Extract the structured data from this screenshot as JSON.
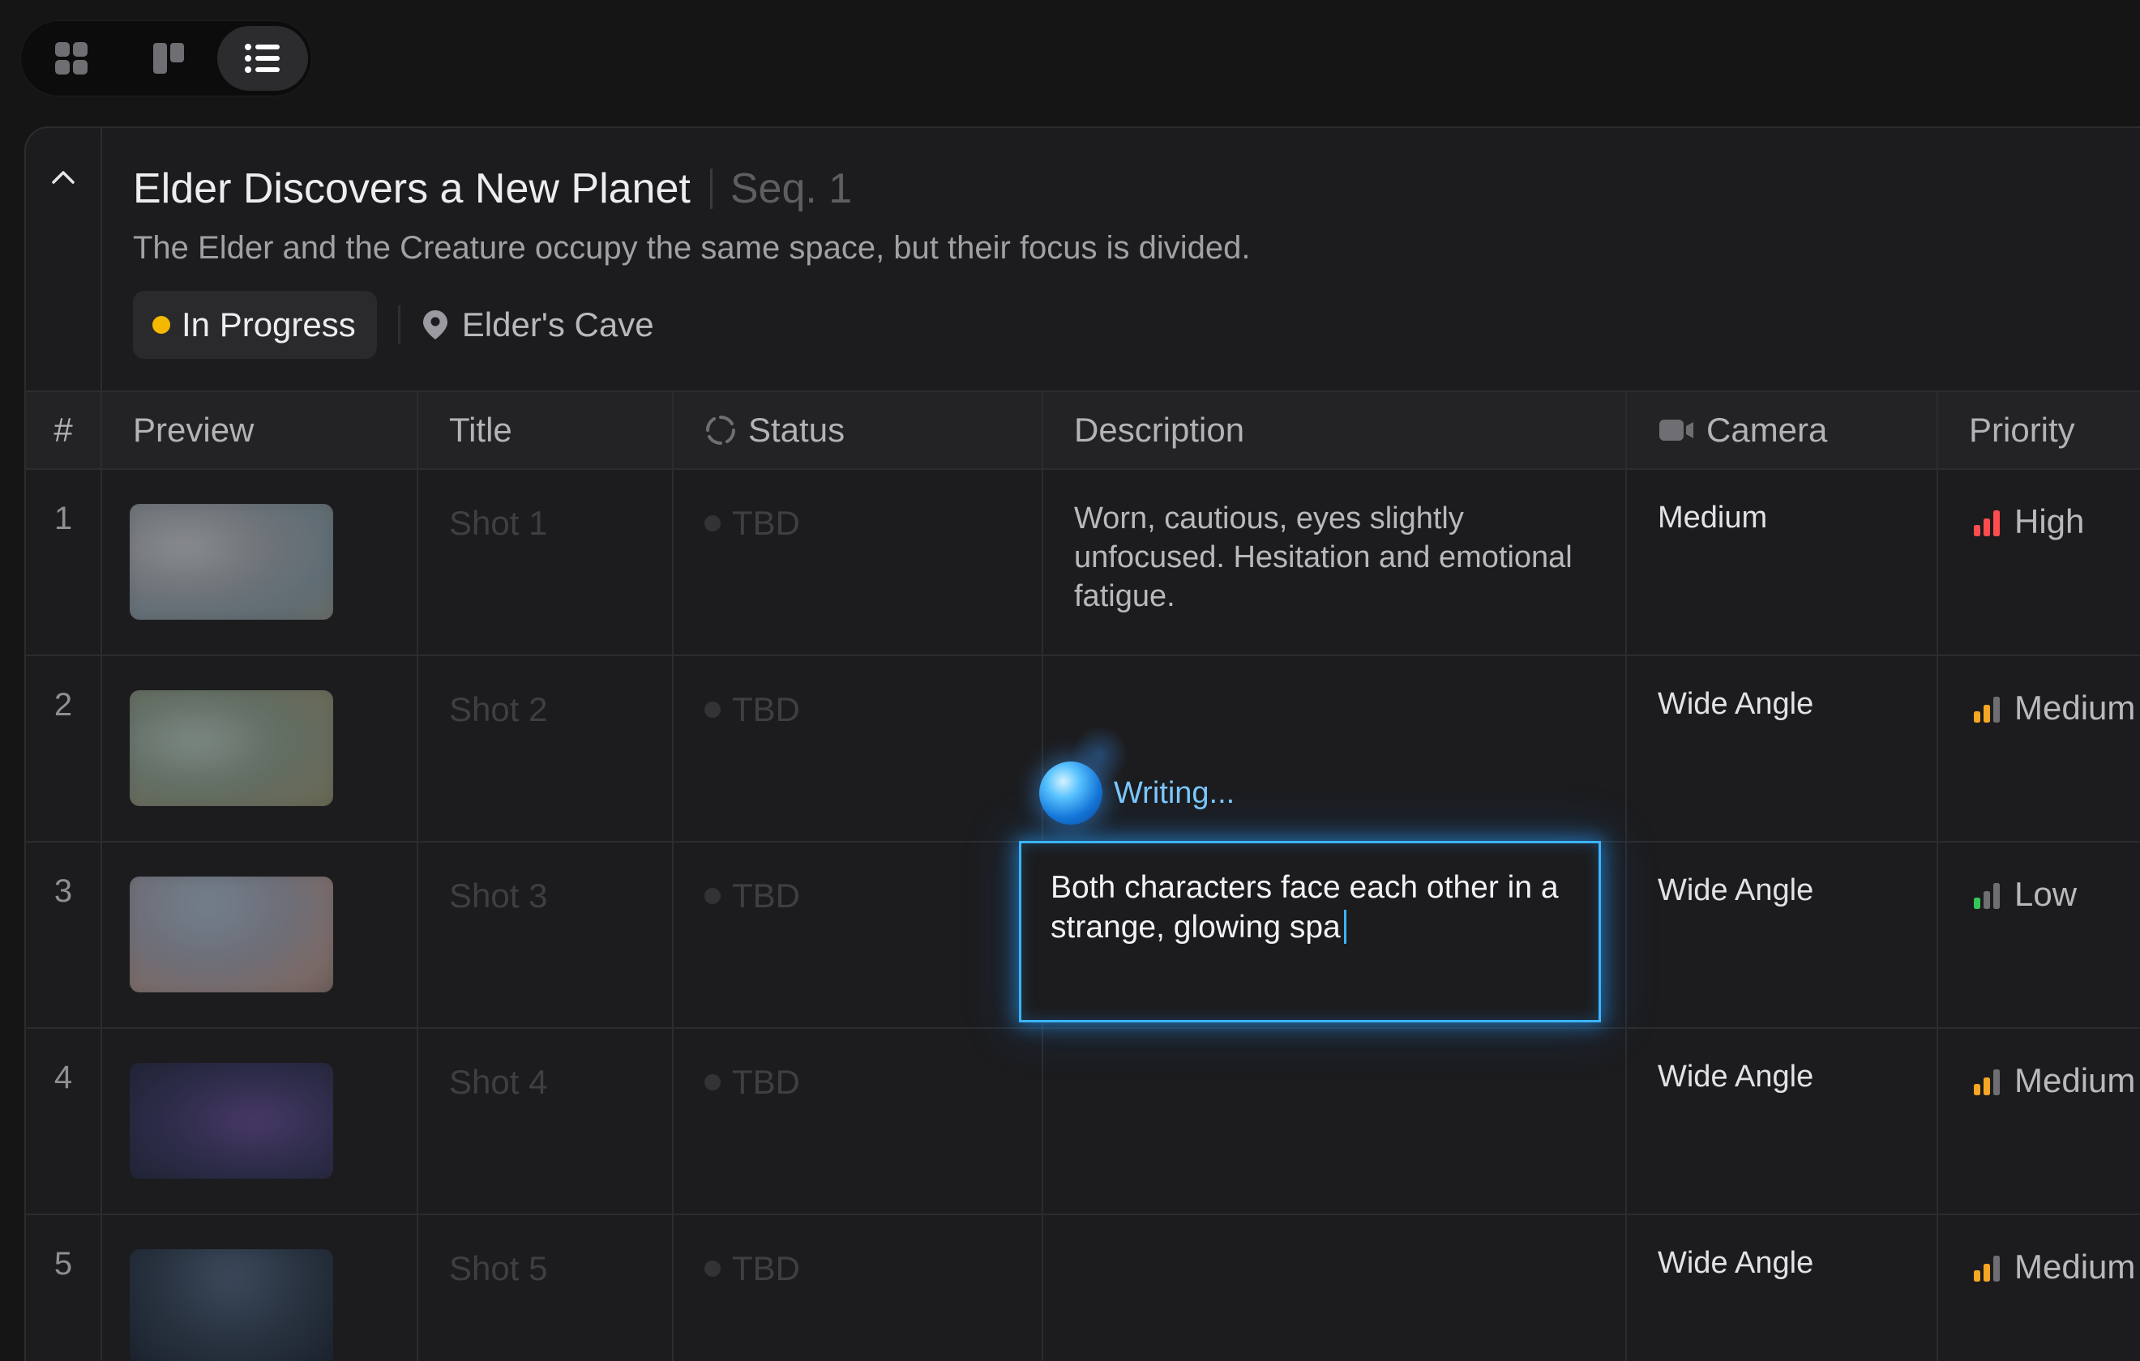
{
  "view_switcher": {
    "options": [
      {
        "icon": "grid-view-icon",
        "active": false
      },
      {
        "icon": "board-view-icon",
        "active": false
      },
      {
        "icon": "list-view-icon",
        "active": true
      }
    ]
  },
  "sequence": {
    "title": "Elder Discovers a New Planet",
    "number": "Seq. 1",
    "description": "The Elder and the Creature occupy the same space, but their focus is divided.",
    "status": {
      "label": "In Progress",
      "color": "#f5b800"
    },
    "location": "Elder's Cave"
  },
  "table": {
    "columns": {
      "num": "#",
      "preview": "Preview",
      "title": "Title",
      "status": "Status",
      "description": "Description",
      "camera": "Camera",
      "priority": "Priority"
    },
    "rows": [
      {
        "num": "1",
        "title": "Shot 1",
        "status": "TBD",
        "description": "Worn, cautious, eyes slightly unfocused. Hesitation and emotional fatigue.",
        "camera": "Medium",
        "priority": "High",
        "priority_level": 3,
        "priority_color": "#ff4d4f"
      },
      {
        "num": "2",
        "title": "Shot 2",
        "status": "TBD",
        "description": "",
        "camera": "Wide Angle",
        "priority": "Medium",
        "priority_level": 2,
        "priority_color": "#f5a623"
      },
      {
        "num": "3",
        "title": "Shot 3",
        "status": "TBD",
        "description": "",
        "camera": "Wide Angle",
        "priority": "Low",
        "priority_level": 1,
        "priority_color": "#34c759"
      },
      {
        "num": "4",
        "title": "Shot 4",
        "status": "TBD",
        "description": "",
        "camera": "Wide Angle",
        "priority": "Medium",
        "priority_level": 2,
        "priority_color": "#f5a623"
      },
      {
        "num": "5",
        "title": "Shot 5",
        "status": "TBD",
        "description": "",
        "camera": "Wide Angle",
        "priority": "Medium",
        "priority_level": 2,
        "priority_color": "#f5a623"
      }
    ]
  },
  "ai_writing": {
    "label": "Writing...",
    "draft_text": "Both characters face each other in a strange, glowing spa"
  }
}
